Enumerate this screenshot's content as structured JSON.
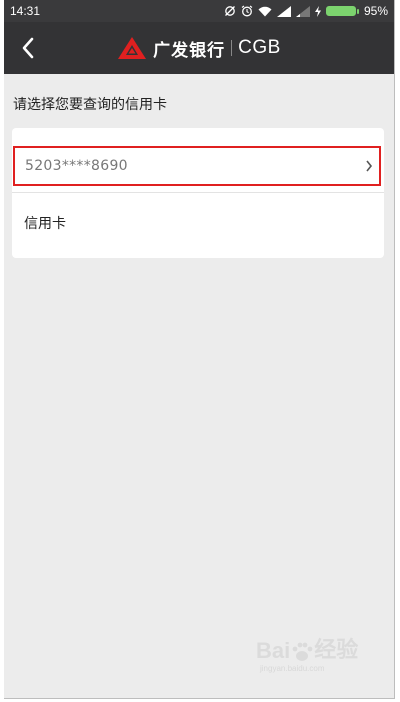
{
  "status_bar": {
    "time": "14:31",
    "battery": "95%"
  },
  "nav": {
    "bank_name_cn": "广发银行",
    "bank_name_en": "CGB"
  },
  "prompt": "请选择您要查询的信用卡",
  "card": {
    "number": "5203****8690",
    "type": "信用卡"
  },
  "watermark": {
    "brand": "Bai",
    "tail": "经验",
    "sub": "jingyan.baidu.com"
  },
  "colors": {
    "status_bg": "#3a3a3c",
    "nav_bg": "#333335",
    "highlight": "#e02020",
    "logo": "#e02020",
    "page_bg": "#ececec"
  }
}
